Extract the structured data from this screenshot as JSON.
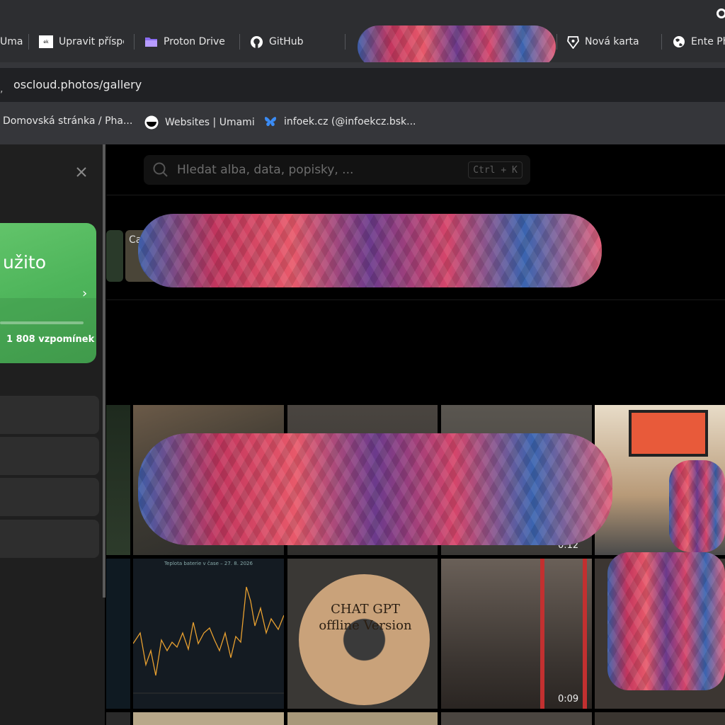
{
  "browser": {
    "tabs": [
      {
        "label": "Uma",
        "icon": "umami-icon"
      },
      {
        "label": "Upravit příspěv",
        "icon": "site-favicon-icon"
      },
      {
        "label": "Proton Drive",
        "icon": "proton-drive-icon"
      },
      {
        "label": "GitHub",
        "icon": "github-icon"
      },
      {
        "label": "Nová karta",
        "icon": "brave-icon"
      },
      {
        "label": "Ente Ph",
        "icon": "globe-icon"
      }
    ],
    "url": "oscloud.photos/gallery",
    "bookmarks": [
      {
        "label": "Domovská stránka / Pha...",
        "icon": "page-icon"
      },
      {
        "label": "Websites | Umami",
        "icon": "umami-icon"
      },
      {
        "label": "infoek.cz (@infoekcz.bsk...",
        "icon": "bluesky-icon"
      }
    ]
  },
  "sidebar": {
    "storage": {
      "title": "užito",
      "memories": "1 808 vzpomínek"
    },
    "accent_color": "#52b85c"
  },
  "search": {
    "placeholder": "Hledat alba, data, popisky, ...",
    "shortcut": "Ctrl + K"
  },
  "albums": {
    "first_label": "Camera"
  },
  "gallery": {
    "durations": [
      "0:12",
      "0:09"
    ],
    "chart_thumb_title": "Teplota baterie v čase – 27. 8. 2026",
    "cd_text": "CHAT GPT offline Version"
  }
}
